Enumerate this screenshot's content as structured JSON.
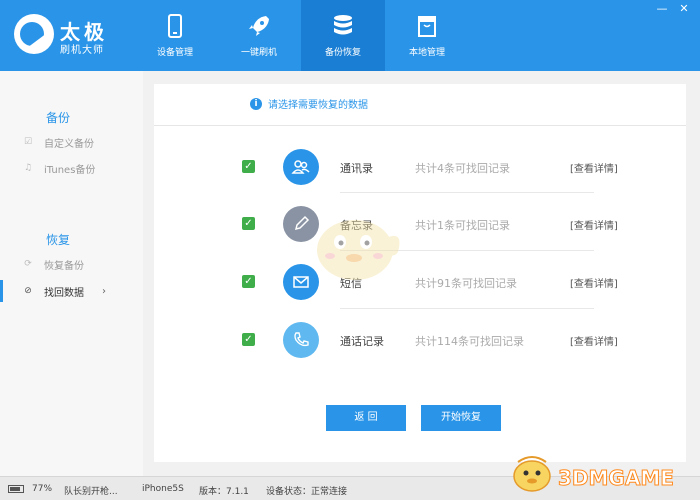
{
  "app": {
    "title": "太极",
    "subtitle": "刷机大师"
  },
  "nav": [
    {
      "label": "设备管理",
      "icon": "phone-icon"
    },
    {
      "label": "一键刷机",
      "icon": "rocket-icon"
    },
    {
      "label": "备份恢复",
      "icon": "database-icon",
      "active": true
    },
    {
      "label": "本地管理",
      "icon": "box-icon"
    }
  ],
  "window_controls": [
    "minimize",
    "close"
  ],
  "sidebar": {
    "backup_header": "备份",
    "backup_items": [
      {
        "label": "自定义备份",
        "icon": "checkbox-icon"
      },
      {
        "label": "iTunes备份",
        "icon": "music-note-icon"
      }
    ],
    "restore_header": "恢复",
    "restore_items": [
      {
        "label": "恢复备份",
        "icon": "restore-icon"
      },
      {
        "label": "找回数据",
        "icon": "recover-icon",
        "active": true
      }
    ]
  },
  "main": {
    "prompt": "请选择需要恢复的数据",
    "rows": [
      {
        "name": "通讯录",
        "count": "共计4条可找回记录",
        "detail": "[查看详情]",
        "checked": true,
        "icon": "contacts-icon",
        "color": "#2a95e8"
      },
      {
        "name": "备忘录",
        "count": "共计1条可找回记录",
        "detail": "[查看详情]",
        "checked": true,
        "icon": "pencil-icon",
        "color": "#8a93a3"
      },
      {
        "name": "短信",
        "count": "共计91条可找回记录",
        "detail": "[查看详情]",
        "checked": true,
        "icon": "envelope-icon",
        "color": "#2a95e8"
      },
      {
        "name": "通话记录",
        "count": "共计114条可找回记录",
        "detail": "[查看详情]",
        "checked": true,
        "icon": "phone-call-icon",
        "color": "#5fb8ef"
      }
    ],
    "back_button": "返 回",
    "start_button": "开始恢复"
  },
  "status": {
    "battery": "77%",
    "device_name": "队长别开枪...",
    "model": "iPhone5S",
    "version": "版本：7.1.1",
    "device_state": "设备状态：正常连接"
  },
  "watermark": "3DMGAME",
  "colors": {
    "brand": "#2a95e8",
    "brand_active": "#1a7fd4",
    "check": "#3fae4a"
  }
}
